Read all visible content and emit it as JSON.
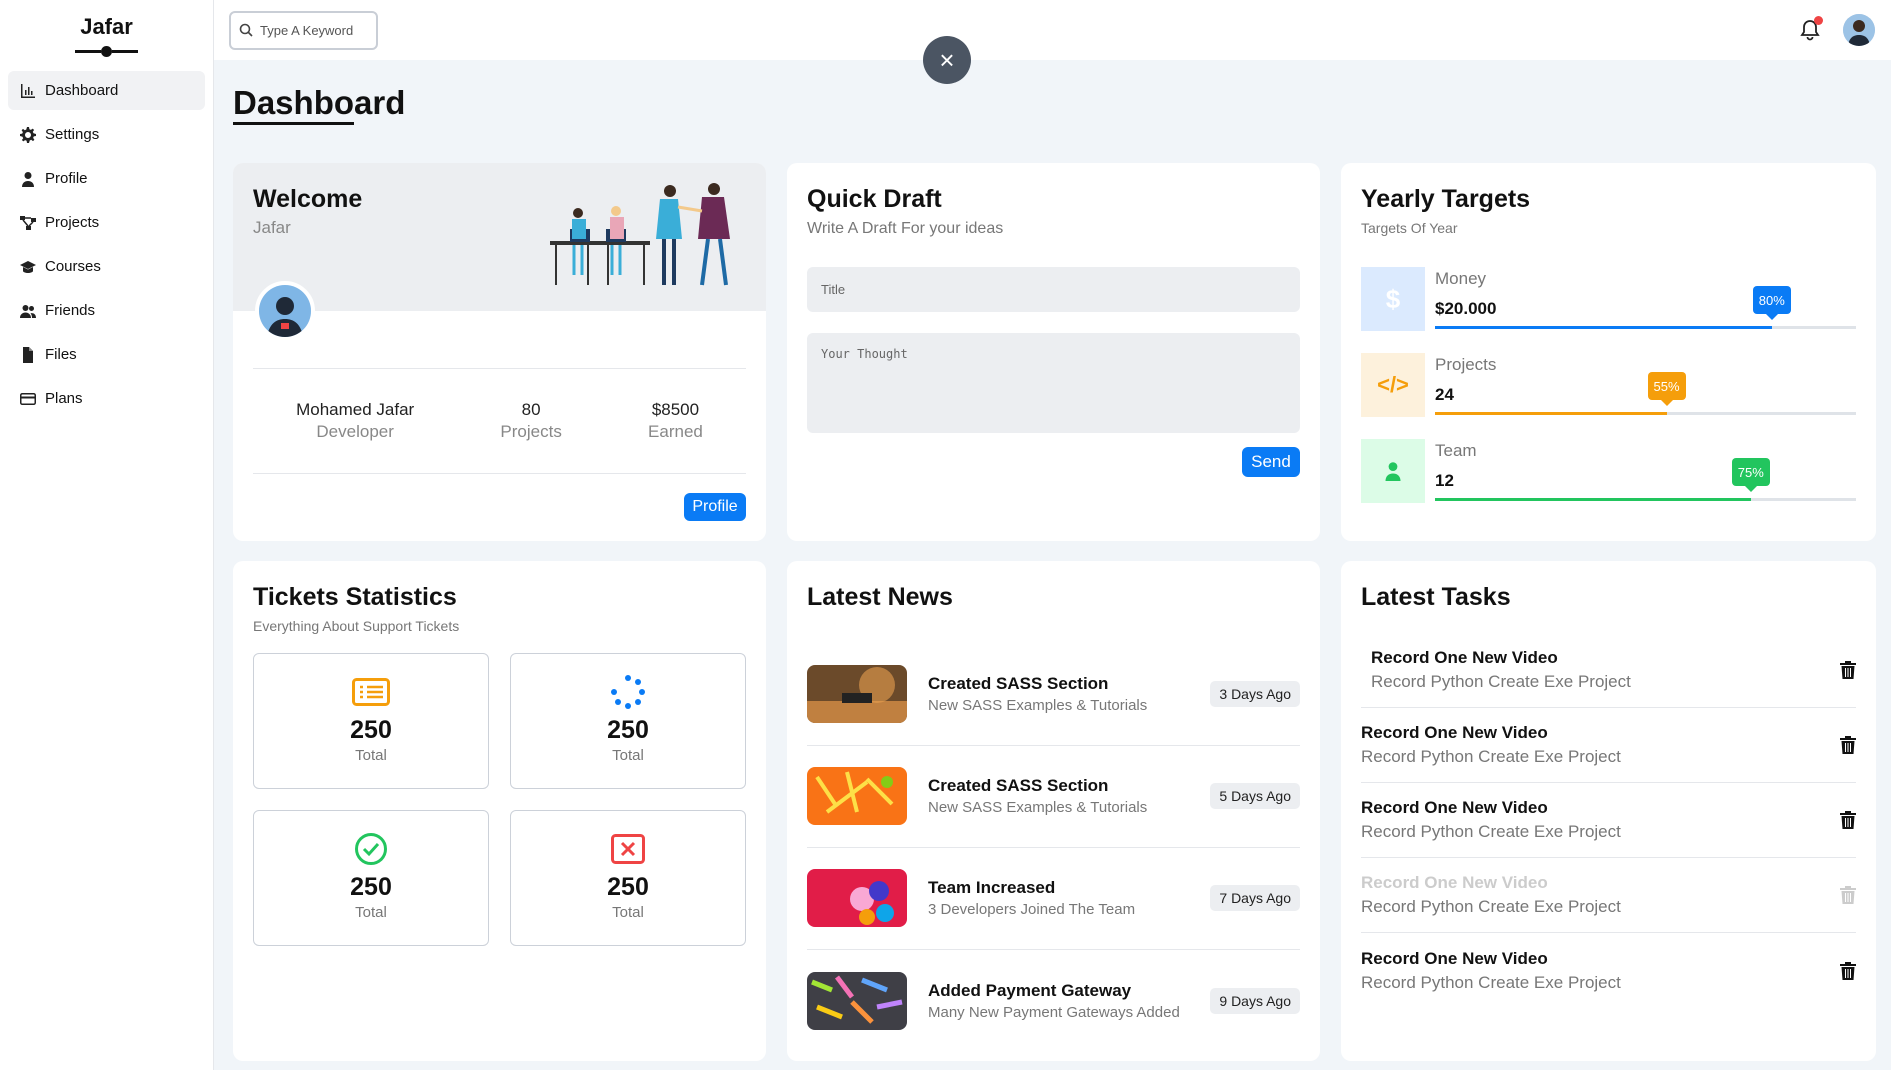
{
  "sidebar": {
    "logo": "Jafar",
    "items": [
      {
        "label": "Dashboard",
        "icon": "chart-icon",
        "active": true
      },
      {
        "label": "Settings",
        "icon": "gear-icon"
      },
      {
        "label": "Profile",
        "icon": "user-icon"
      },
      {
        "label": "Projects",
        "icon": "diagram-icon"
      },
      {
        "label": "Courses",
        "icon": "graduation-cap-icon"
      },
      {
        "label": "Friends",
        "icon": "users-icon"
      },
      {
        "label": "Files",
        "icon": "file-icon"
      },
      {
        "label": "Plans",
        "icon": "credit-card-icon"
      }
    ]
  },
  "topbar": {
    "search_placeholder": "Type A Keyword",
    "notification": true
  },
  "page": {
    "title": "Dashboard",
    "close": "×"
  },
  "welcome": {
    "title": "Welcome",
    "name": "Jafar",
    "stats": [
      {
        "value": "Mohamed Jafar",
        "label": "Developer"
      },
      {
        "value": "80",
        "label": "Projects"
      },
      {
        "value": "$8500",
        "label": "Earned"
      }
    ],
    "button": "Profile"
  },
  "draft": {
    "title": "Quick Draft",
    "subtitle": "Write A Draft For your ideas",
    "title_placeholder": "Title",
    "body_placeholder": "Your Thought",
    "button": "Send"
  },
  "targets": {
    "title": "Yearly Targets",
    "subtitle": "Targets Of Year",
    "items": [
      {
        "label": "Money",
        "value": "$20.000",
        "percent": 80,
        "percent_label": "80%",
        "color": "#0a7bf5",
        "bg": "#dbeafe",
        "icon": "dollar-icon",
        "icon_text": "$"
      },
      {
        "label": "Projects",
        "value": "24",
        "percent": 55,
        "percent_label": "55%",
        "color": "#f59e0b",
        "bg": "#fdf1dc",
        "icon": "code-icon",
        "icon_text": "</>"
      },
      {
        "label": "Team",
        "value": "12",
        "percent": 75,
        "percent_label": "75%",
        "color": "#22c55e",
        "bg": "#dcfce7",
        "icon": "user-icon",
        "icon_text": ""
      }
    ]
  },
  "tickets": {
    "title": "Tickets Statistics",
    "subtitle": "Everything About Support Tickets",
    "items": [
      {
        "value": "250",
        "label": "Total",
        "icon": "list-icon",
        "color": "#f59e0b"
      },
      {
        "value": "250",
        "label": "Total",
        "icon": "spinner-icon",
        "color": "#0a7bf5"
      },
      {
        "value": "250",
        "label": "Total",
        "icon": "check-circle-icon",
        "color": "#22c55e"
      },
      {
        "value": "250",
        "label": "Total",
        "icon": "x-square-icon",
        "color": "#ef4444"
      }
    ]
  },
  "news": {
    "title": "Latest News",
    "items": [
      {
        "title": "Created SASS Section",
        "subtitle": "New SASS Examples & Tutorials",
        "date": "3 Days Ago"
      },
      {
        "title": "Created SASS Section",
        "subtitle": "New SASS Examples & Tutorials",
        "date": "5 Days Ago"
      },
      {
        "title": "Team Increased",
        "subtitle": "3 Developers Joined The Team",
        "date": "7 Days Ago"
      },
      {
        "title": "Added Payment Gateway",
        "subtitle": "Many New Payment Gateways Added",
        "date": "9 Days Ago"
      }
    ]
  },
  "tasks": {
    "title": "Latest Tasks",
    "items": [
      {
        "title": "Record One New Video",
        "subtitle": "Record Python Create Exe Project",
        "done": false
      },
      {
        "title": "Record One New Video",
        "subtitle": "Record Python Create Exe Project",
        "done": false
      },
      {
        "title": "Record One New Video",
        "subtitle": "Record Python Create Exe Project",
        "done": false
      },
      {
        "title": "Record One New Video",
        "subtitle": "Record Python Create Exe Project",
        "done": true
      },
      {
        "title": "Record One New Video",
        "subtitle": "Record Python Create Exe Project",
        "done": false
      }
    ]
  }
}
